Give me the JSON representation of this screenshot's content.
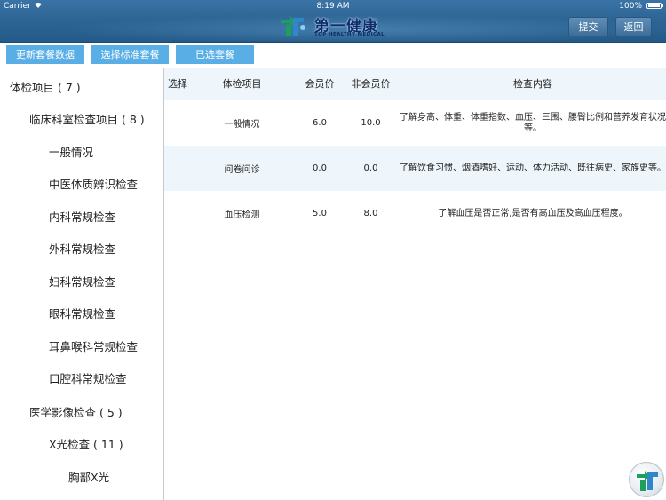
{
  "status_bar": {
    "carrier": "Carrier",
    "time": "8:19 AM",
    "battery": "100%"
  },
  "header": {
    "logo_cn": "第一健康",
    "logo_en": "TOP HEALTHY MEDICAL",
    "submit_label": "提交",
    "back_label": "返回"
  },
  "toolbar": {
    "update_label": "更新套餐数据",
    "choose_label": "选择标准套餐",
    "selected_label": "已选套餐"
  },
  "sidebar": {
    "items": [
      {
        "label": "体检项目 ( 7 )"
      },
      {
        "label": "临床科室检查项目 ( 8 )"
      },
      {
        "label": "一般情况"
      },
      {
        "label": "中医体质辨识检查"
      },
      {
        "label": "内科常规检查"
      },
      {
        "label": "外科常规检查"
      },
      {
        "label": "妇科常规检查"
      },
      {
        "label": "眼科常规检查"
      },
      {
        "label": "耳鼻喉科常规检查"
      },
      {
        "label": "口腔科常规检查"
      },
      {
        "label": "医学影像检查 ( 5 )"
      },
      {
        "label": "X光检查 ( 11 )"
      },
      {
        "label": "胸部X光"
      }
    ]
  },
  "table": {
    "headers": {
      "select": "选择",
      "item": "体检项目",
      "member_price": "会员价",
      "non_member_price": "非会员价",
      "content": "检查内容"
    },
    "rows": [
      {
        "item": "一般情况",
        "member_price": "6.0",
        "non_member_price": "10.0",
        "content": "了解身高、体重、体重指数、血压、三围、腰臀比例和营养发育状况等。"
      },
      {
        "item": "问卷问诊",
        "member_price": "0.0",
        "non_member_price": "0.0",
        "content": "了解饮食习惯、烟酒嗜好、运动、体力活动、既往病史、家族史等。"
      },
      {
        "item": "血压检测",
        "member_price": "5.0",
        "non_member_price": "8.0",
        "content": "了解血压是否正常,是否有高血压及高血压程度。"
      }
    ]
  },
  "colors": {
    "header": "#2c6493",
    "button_blue": "#5aaee6",
    "row_alt": "#eef6fb"
  },
  "icons": {
    "wifi": "wifi-icon",
    "battery": "battery-icon",
    "logo": "logo-mark-icon",
    "fab": "app-logo-button-icon"
  }
}
